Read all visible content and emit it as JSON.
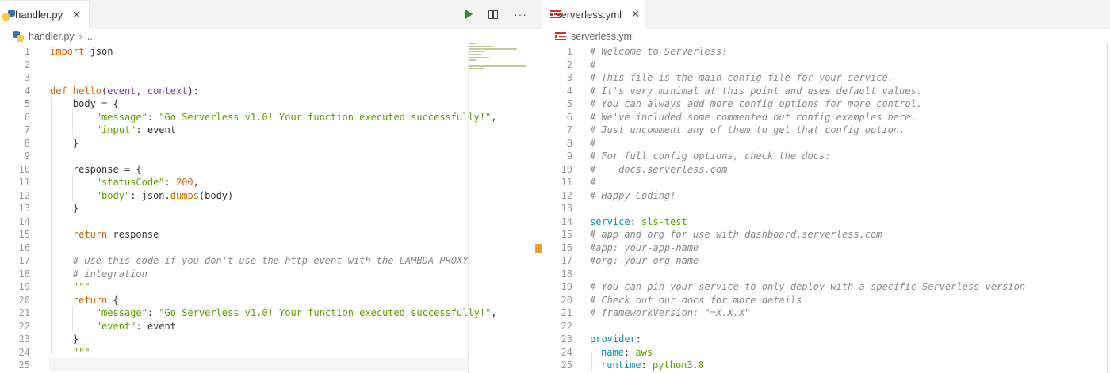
{
  "left": {
    "tab": {
      "label": "handler.py",
      "close": "✕"
    },
    "breadcrumb": {
      "file": "handler.py",
      "sep": "›",
      "rest": "..."
    },
    "actions": {
      "more": "···"
    },
    "lines": [
      {
        "n": "1"
      },
      {
        "n": "2"
      },
      {
        "n": "3"
      },
      {
        "n": "4"
      },
      {
        "n": "5"
      },
      {
        "n": "6"
      },
      {
        "n": "7"
      },
      {
        "n": "8"
      },
      {
        "n": "9"
      },
      {
        "n": "10"
      },
      {
        "n": "11"
      },
      {
        "n": "12"
      },
      {
        "n": "13"
      },
      {
        "n": "14"
      },
      {
        "n": "15"
      },
      {
        "n": "16"
      },
      {
        "n": "17"
      },
      {
        "n": "18"
      },
      {
        "n": "19"
      },
      {
        "n": "20"
      },
      {
        "n": "21"
      },
      {
        "n": "22"
      },
      {
        "n": "23"
      },
      {
        "n": "24"
      },
      {
        "n": "25"
      }
    ],
    "code": {
      "l1_import": "import",
      "l1_rest": " json",
      "l4_def": "def",
      "l4_fn": " hello",
      "l4_p1": "(",
      "l4_event": "event",
      "l4_c": ", ",
      "l4_ctx": "context",
      "l4_end": "):",
      "l5": "body = {",
      "l6_key": "\"message\"",
      "l6_colon": ": ",
      "l6_val": "\"Go Serverless v1.0! Your function executed successfully!\"",
      "l6_end": ",",
      "l7_key": "\"input\"",
      "l7_rest": ": event",
      "l8": "}",
      "l10": "response = {",
      "l11_key": "\"statusCode\"",
      "l11_colon": ": ",
      "l11_num": "200",
      "l11_end": ",",
      "l12_key": "\"body\"",
      "l12_a": ": json.",
      "l12_fn": "dumps",
      "l12_b": "(body)",
      "l13": "}",
      "l15_ret": "return",
      "l15_rest": " response",
      "l17": "# Use this code if you don't use the http event with the LAMBDA-PROXY",
      "l18": "# integration",
      "l19": "\"\"\"",
      "l20_ret": "return",
      "l20_rest": " {",
      "l21_key": "\"message\"",
      "l21_colon": ": ",
      "l21_val": "\"Go Serverless v1.0! Your function executed successfully!\"",
      "l21_end": ",",
      "l22_key": "\"event\"",
      "l22_rest": ": event",
      "l23": "}",
      "l24": "\"\"\""
    }
  },
  "right": {
    "tab": {
      "label": "serverless.yml",
      "close": "✕"
    },
    "breadcrumb": {
      "file": "serverless.yml"
    },
    "lines": [
      {
        "n": "1",
        "t": "# Welcome to Serverless!",
        "c": "cm"
      },
      {
        "n": "2",
        "t": "#",
        "c": "cm"
      },
      {
        "n": "3",
        "t": "# This file is the main config file for your service.",
        "c": "cm"
      },
      {
        "n": "4",
        "t": "# It's very minimal at this point and uses default values.",
        "c": "cm"
      },
      {
        "n": "5",
        "t": "# You can always add more config options for more control.",
        "c": "cm"
      },
      {
        "n": "6",
        "t": "# We've included some commented out config examples here.",
        "c": "cm"
      },
      {
        "n": "7",
        "t": "# Just uncomment any of them to get that config option.",
        "c": "cm"
      },
      {
        "n": "8",
        "t": "#",
        "c": "cm"
      },
      {
        "n": "9",
        "t": "# For full config options, check the docs:",
        "c": "cm"
      },
      {
        "n": "10",
        "t": "#    docs.serverless.com",
        "c": "cm"
      },
      {
        "n": "11",
        "t": "#",
        "c": "cm"
      },
      {
        "n": "12",
        "t": "# Happy Coding!",
        "c": "cm"
      },
      {
        "n": "13",
        "t": "",
        "c": ""
      },
      {
        "n": "14",
        "k": "service",
        "v": "sls-test"
      },
      {
        "n": "15",
        "t": "# app and org for use with dashboard.serverless.com",
        "c": "cm"
      },
      {
        "n": "16",
        "t": "#app: your-app-name",
        "c": "cm"
      },
      {
        "n": "17",
        "t": "#org: your-org-name",
        "c": "cm"
      },
      {
        "n": "18",
        "t": "",
        "c": ""
      },
      {
        "n": "19",
        "t": "# You can pin your service to only deploy with a specific Serverless version",
        "c": "cm"
      },
      {
        "n": "20",
        "t": "# Check out our docs for more details",
        "c": "cm"
      },
      {
        "n": "21",
        "t": "# frameworkVersion: \"=X.X.X\"",
        "c": "cm"
      },
      {
        "n": "22",
        "t": "",
        "c": ""
      },
      {
        "n": "23",
        "k": "provider",
        "v": ""
      },
      {
        "n": "24",
        "k": "name",
        "v": "aws",
        "indent": true
      },
      {
        "n": "25",
        "k": "runtime",
        "v": "python3.8",
        "indent": true
      }
    ],
    "colon": ":"
  },
  "colors": {
    "keyword": "#af00db",
    "string": "#5e9e00",
    "comment": "#8b8b8b",
    "yaml_key": "#0a8fbf"
  }
}
